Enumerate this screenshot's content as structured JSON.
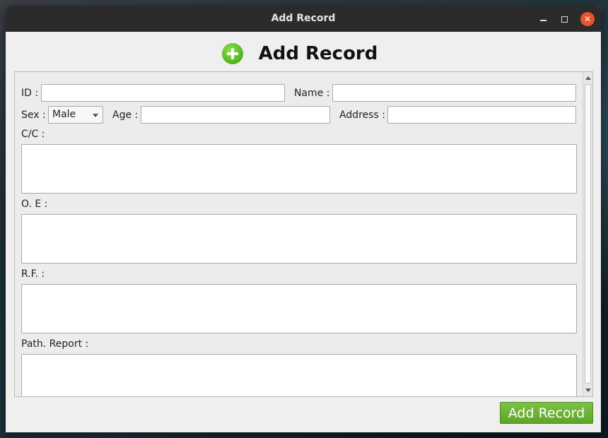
{
  "window": {
    "title": "Add Record"
  },
  "header": {
    "icon": "plus-circle-icon",
    "title": "Add Record",
    "accent": "#5db422"
  },
  "form": {
    "id_label": "ID :",
    "id_value": "",
    "name_label": "Name :",
    "name_value": "",
    "sex_label": "Sex :",
    "sex_selected": "Male",
    "age_label": "Age :",
    "age_value": "",
    "address_label": "Address :",
    "address_value": "",
    "cc_label": "C/C :",
    "oe_label": "O. E :",
    "rf_label": "R.F. :",
    "path_report_label": "Path. Report :"
  },
  "actions": {
    "submit_label": "Add Record",
    "submit_color": "#6cb536"
  }
}
